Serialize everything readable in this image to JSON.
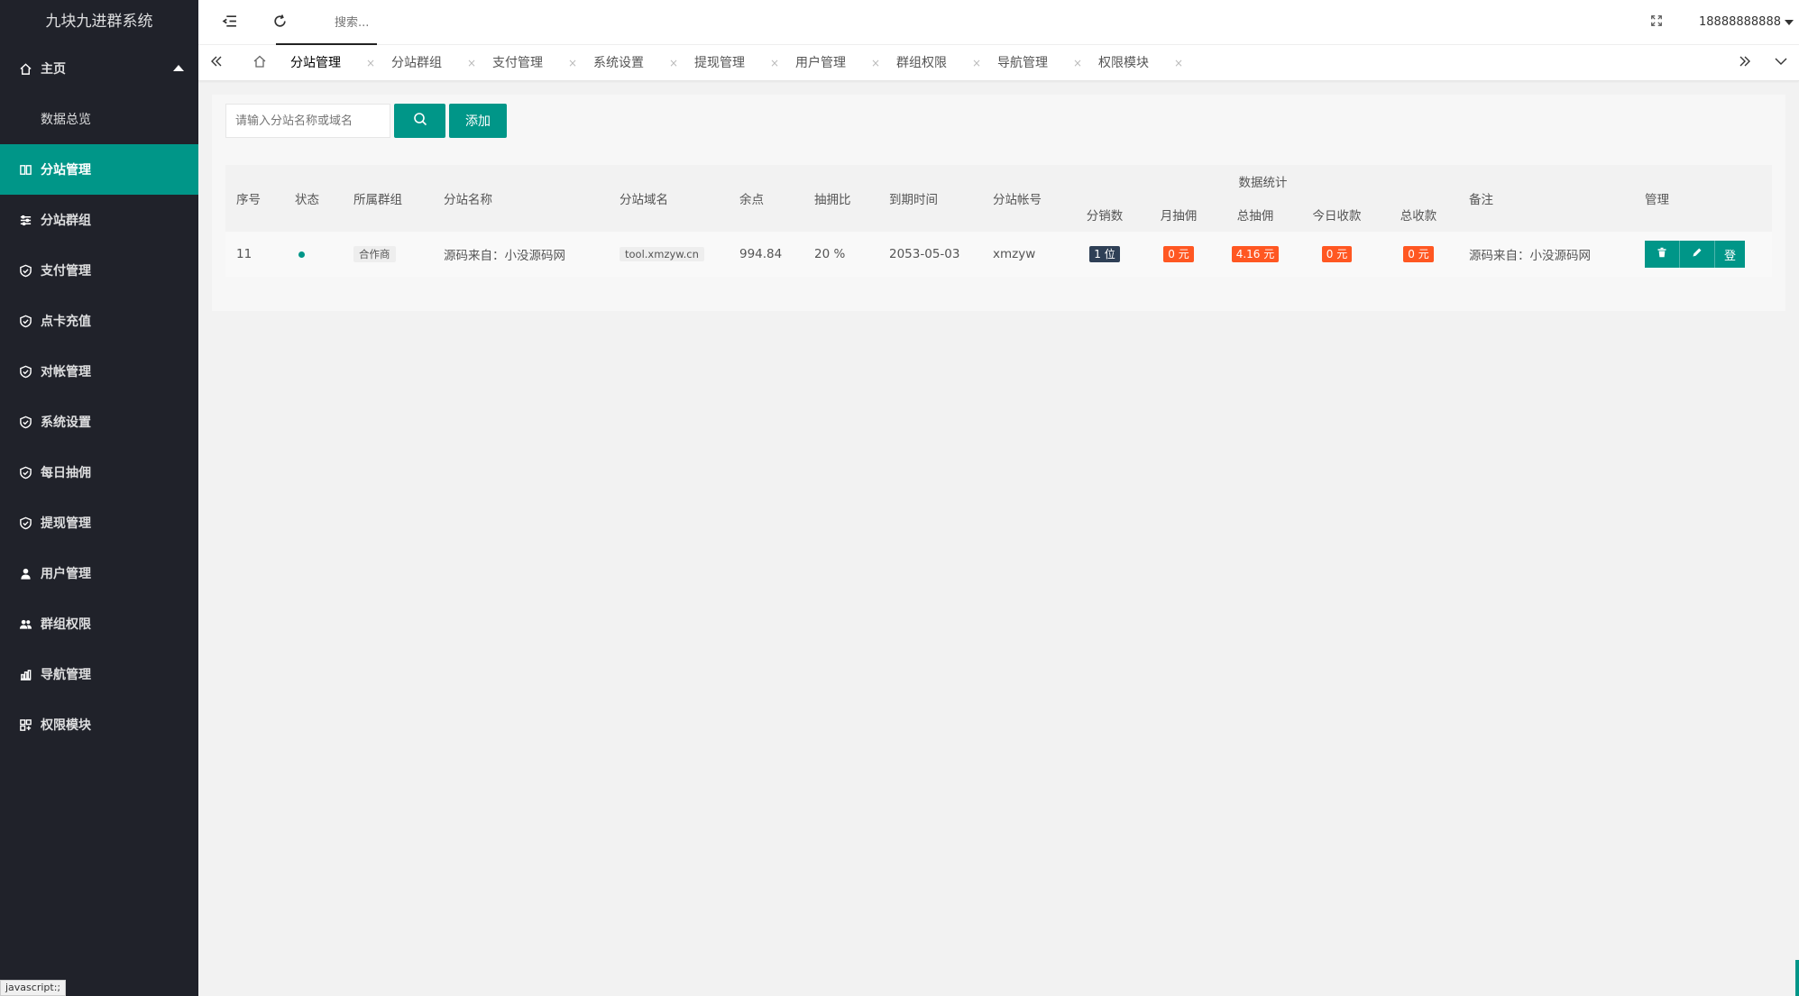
{
  "app": {
    "title": "九块九进群系统"
  },
  "sidebar": {
    "items": [
      {
        "label": "主页",
        "icon": "home-icon"
      },
      {
        "label": "数据总览",
        "icon": ""
      },
      {
        "label": "分站管理",
        "icon": "columns-icon"
      },
      {
        "label": "分站群组",
        "icon": "sliders-icon"
      },
      {
        "label": "支付管理",
        "icon": "shield-check-icon"
      },
      {
        "label": "点卡充值",
        "icon": "shield-check-icon"
      },
      {
        "label": "对帐管理",
        "icon": "shield-check-icon"
      },
      {
        "label": "系统设置",
        "icon": "shield-check-icon"
      },
      {
        "label": "每日抽佣",
        "icon": "shield-check-icon"
      },
      {
        "label": "提现管理",
        "icon": "shield-check-icon"
      },
      {
        "label": "用户管理",
        "icon": "user-icon"
      },
      {
        "label": "群组权限",
        "icon": "users-icon"
      },
      {
        "label": "导航管理",
        "icon": "chart-icon"
      },
      {
        "label": "权限模块",
        "icon": "modules-icon"
      }
    ]
  },
  "header": {
    "search_placeholder": "搜索...",
    "user": "18888888888"
  },
  "tabs": [
    "分站管理",
    "分站群组",
    "支付管理",
    "系统设置",
    "提现管理",
    "用户管理",
    "群组权限",
    "导航管理",
    "权限模块"
  ],
  "toolbar": {
    "keyword_placeholder": "请输入分站名称或域名",
    "add_label": "添加"
  },
  "table": {
    "headers": {
      "id": "序号",
      "status": "状态",
      "group": "所属群组",
      "name": "分站名称",
      "domain": "分站域名",
      "balance": "余点",
      "ratio": "抽拥比",
      "expire": "到期时间",
      "account": "分站帐号",
      "stats": "数据统计",
      "sales": "分销数",
      "month_comm": "月抽佣",
      "total_comm": "总抽佣",
      "today_income": "今日收款",
      "total_income": "总收款",
      "remark": "备注",
      "manage": "管理"
    },
    "rows": [
      {
        "id": "11",
        "group": "合作商",
        "name": "源码来自：小没源码网",
        "domain": "tool.xmzyw.cn",
        "balance": "994.84",
        "ratio": "20 %",
        "expire": "2053-05-03",
        "account": "xmzyw",
        "sales": "1 位",
        "month_comm": "0 元",
        "total_comm": "4.16 元",
        "today_income": "0 元",
        "total_income": "0 元",
        "remark": "源码来自：小没源码网",
        "login": "登"
      }
    ]
  },
  "status_bar": "javascript:;",
  "colors": {
    "accent": "#009688",
    "sidebar": "#20222a",
    "orange": "#ff5722",
    "dark": "#2f4056"
  }
}
